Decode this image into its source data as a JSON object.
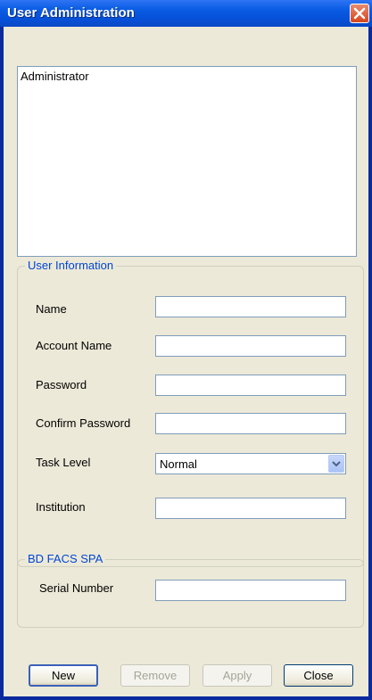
{
  "window": {
    "title": "User Administration"
  },
  "user_list": {
    "items": [
      "Administrator"
    ]
  },
  "user_info": {
    "legend": "User Information",
    "name_label": "Name",
    "name_value": "",
    "account_label": "Account Name",
    "account_value": "",
    "password_label": "Password",
    "password_value": "",
    "confirm_label": "Confirm Password",
    "confirm_value": "",
    "task_level_label": "Task Level",
    "task_level_value": "Normal",
    "institution_label": "Institution",
    "institution_value": ""
  },
  "spa": {
    "legend": "BD FACS SPA",
    "serial_label": "Serial Number",
    "serial_value": ""
  },
  "buttons": {
    "new": "New",
    "remove": "Remove",
    "apply": "Apply",
    "close": "Close"
  },
  "colors": {
    "title_bar": "#0a5de4",
    "legend_text": "#0046d5",
    "close_button": "#d6451d"
  }
}
